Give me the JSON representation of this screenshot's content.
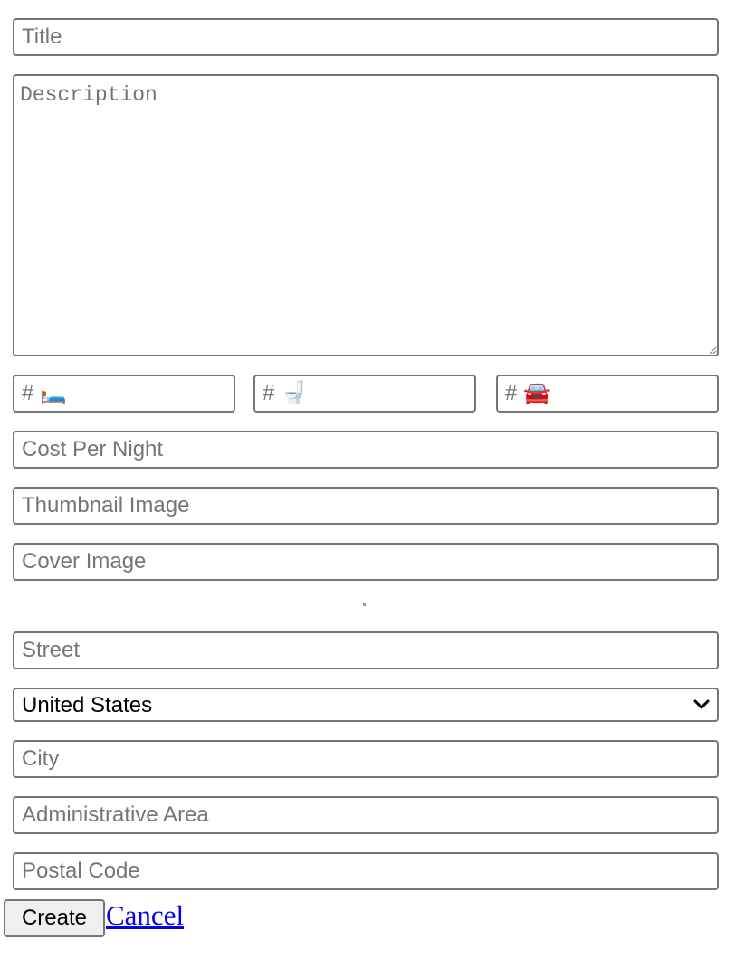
{
  "form": {
    "title": {
      "placeholder": "Title",
      "value": ""
    },
    "description": {
      "placeholder": "Description",
      "value": ""
    },
    "bedrooms": {
      "placeholder": "# 🛏️",
      "value": ""
    },
    "bathrooms": {
      "placeholder": "# 🚽",
      "value": ""
    },
    "parking": {
      "placeholder": "# 🚘",
      "value": ""
    },
    "cost_per_night": {
      "placeholder": "Cost Per Night",
      "value": ""
    },
    "thumbnail_image": {
      "placeholder": "Thumbnail Image",
      "value": ""
    },
    "cover_image": {
      "placeholder": "Cover Image",
      "value": ""
    },
    "street": {
      "placeholder": "Street",
      "value": ""
    },
    "country": {
      "selected": "United States"
    },
    "city": {
      "placeholder": "City",
      "value": ""
    },
    "administrative_area": {
      "placeholder": "Administrative Area",
      "value": ""
    },
    "postal_code": {
      "placeholder": "Postal Code",
      "value": ""
    }
  },
  "actions": {
    "create_label": "Create",
    "cancel_label": "Cancel"
  },
  "colors": {
    "border": "#767676",
    "placeholder": "#757575",
    "button_bg": "#efefef",
    "link": "#0000ee"
  },
  "icons": {
    "select_arrow": "chevron-down-icon",
    "textarea_resize": "resize-handle-icon"
  }
}
